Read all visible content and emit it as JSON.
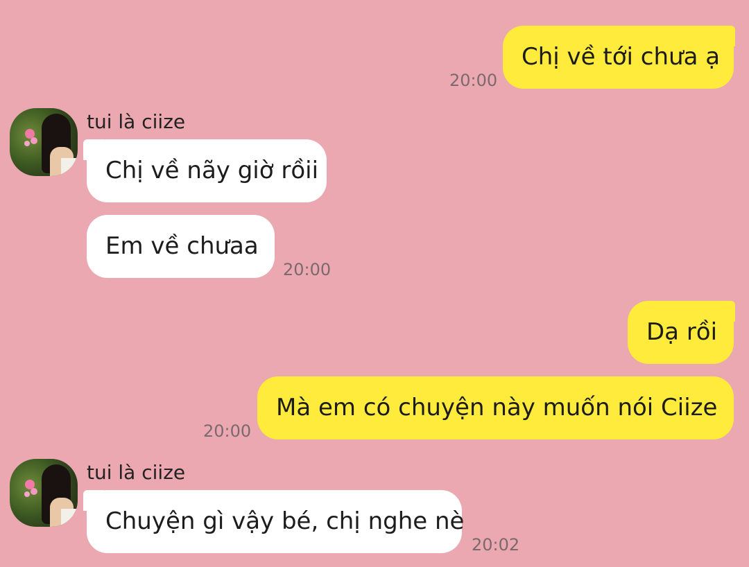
{
  "colors": {
    "background": "#eba8b1",
    "my_bubble": "#ffeb3b",
    "their_bubble": "#ffffff",
    "timestamp": "#7a6a6e"
  },
  "messages": [
    {
      "from": "me",
      "text": "Chị về tới chưa ạ",
      "time": "20:00"
    },
    {
      "from": "them",
      "sender": "tui là ciize",
      "text": "Chị về nãy giờ rồii"
    },
    {
      "from": "them",
      "text": "Em về chưaa",
      "time": "20:00"
    },
    {
      "from": "me",
      "text": "Dạ rồi"
    },
    {
      "from": "me",
      "text": "Mà em có chuyện này muốn nói Ciize",
      "time": "20:00"
    },
    {
      "from": "them",
      "sender": "tui là ciize",
      "text": "Chuyện gì vậy bé, chị nghe nè",
      "time": "20:02"
    }
  ],
  "icons": {
    "avatar": "profile-photo-avatar"
  }
}
